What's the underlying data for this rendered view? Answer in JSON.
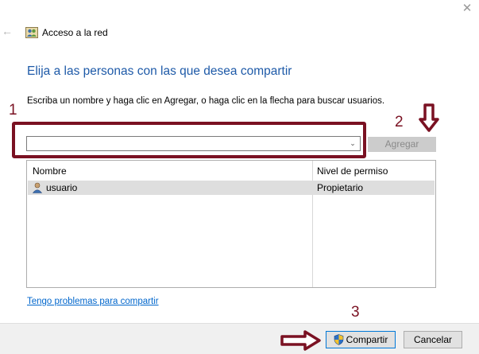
{
  "window": {
    "title": "Acceso a la red",
    "close_glyph": "✕",
    "back_glyph": "←"
  },
  "heading": "Elija a las personas con las que desea compartir",
  "instruction": "Escriba un nombre y haga clic en Agregar, o haga clic en la flecha para buscar usuarios.",
  "user_combo": {
    "value": "",
    "arrow_glyph": "⌄"
  },
  "add_button": {
    "label": "Agregar",
    "enabled": false
  },
  "table": {
    "headers": [
      "Nombre",
      "Nivel de permiso"
    ],
    "rows": [
      {
        "name": "usuario",
        "permission": "Propietario"
      }
    ]
  },
  "help_link": "Tengo problemas para compartir",
  "footer": {
    "share_label": "Compartir",
    "cancel_label": "Cancelar"
  },
  "annotations": {
    "n1": "1",
    "n2": "2",
    "n3": "3",
    "color": "#7a1122"
  },
  "colors": {
    "heading": "#1e5aa8",
    "link": "#0066cc",
    "accent_border": "#0078d7"
  },
  "icons": {
    "app": "network-users-icon",
    "user": "user-icon",
    "shield": "uac-shield-icon",
    "arrow_down": "arrow-down-annotation-icon",
    "arrow_right": "arrow-right-annotation-icon"
  }
}
